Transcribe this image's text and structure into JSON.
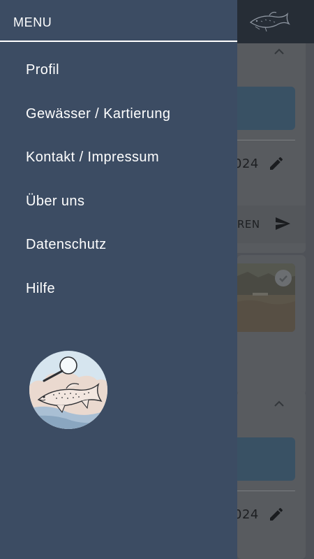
{
  "drawer": {
    "title": "MENU",
    "items": [
      {
        "label": "Profil"
      },
      {
        "label": "Gewässer / Kartierung"
      },
      {
        "label": "Kontakt / Impressum"
      },
      {
        "label": "Über uns"
      },
      {
        "label": "Datenschutz"
      },
      {
        "label": "Hilfe"
      }
    ],
    "logo_icon": "fish-magnifier-logo-icon"
  },
  "background": {
    "header_icon": "fish-logo-icon",
    "card1": {
      "date_fragment": "024",
      "send_fragment": "EREN"
    },
    "card3": {
      "date_fragment": "024"
    }
  },
  "colors": {
    "drawer_bg": "#3c4c63",
    "topbar": "#262d36",
    "accent_blue": "#395164"
  }
}
